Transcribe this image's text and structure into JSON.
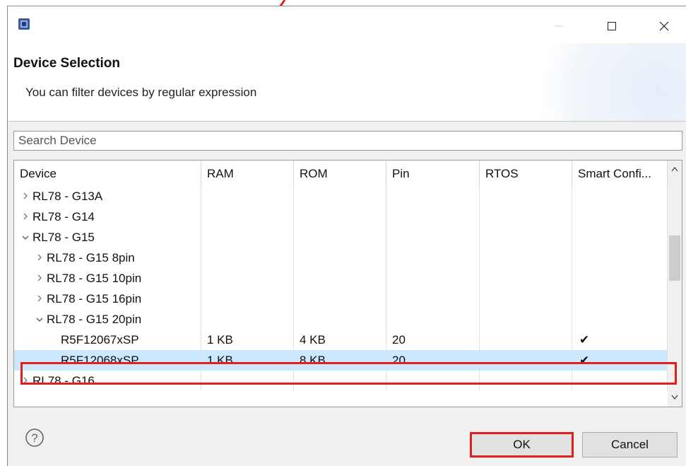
{
  "dialog": {
    "title": "Device Selection",
    "message": "You can filter devices by regular expression"
  },
  "search": {
    "placeholder": "Search Device",
    "value": ""
  },
  "table": {
    "columns": [
      "Device",
      "RAM",
      "ROM",
      "Pin",
      "RTOS",
      "Smart Confi..."
    ],
    "rows": [
      {
        "device": "RL78 - G13A",
        "expander": "collapsed",
        "indent": 0,
        "ram": "",
        "rom": "",
        "pin": "",
        "rtos": "",
        "smart": ""
      },
      {
        "device": "RL78 - G14",
        "expander": "collapsed",
        "indent": 0,
        "ram": "",
        "rom": "",
        "pin": "",
        "rtos": "",
        "smart": ""
      },
      {
        "device": "RL78 - G15",
        "expander": "expanded",
        "indent": 0,
        "ram": "",
        "rom": "",
        "pin": "",
        "rtos": "",
        "smart": ""
      },
      {
        "device": "RL78 - G15 8pin",
        "expander": "collapsed",
        "indent": 1,
        "ram": "",
        "rom": "",
        "pin": "",
        "rtos": "",
        "smart": ""
      },
      {
        "device": "RL78 - G15 10pin",
        "expander": "collapsed",
        "indent": 1,
        "ram": "",
        "rom": "",
        "pin": "",
        "rtos": "",
        "smart": ""
      },
      {
        "device": "RL78 - G15 16pin",
        "expander": "collapsed",
        "indent": 1,
        "ram": "",
        "rom": "",
        "pin": "",
        "rtos": "",
        "smart": ""
      },
      {
        "device": "RL78 - G15 20pin",
        "expander": "expanded",
        "indent": 1,
        "ram": "",
        "rom": "",
        "pin": "",
        "rtos": "",
        "smart": ""
      },
      {
        "device": "R5F12067xSP",
        "expander": "none",
        "indent": 2,
        "ram": "1 KB",
        "rom": "4 KB",
        "pin": "20",
        "rtos": "",
        "smart": "✔"
      },
      {
        "device": "R5F12068xSP",
        "expander": "none",
        "indent": 2,
        "ram": "1 KB",
        "rom": "8 KB",
        "pin": "20",
        "rtos": "",
        "smart": "✔",
        "selected": true
      },
      {
        "device": "RL78 - G16",
        "expander": "collapsed",
        "indent": 0,
        "ram": "",
        "rom": "",
        "pin": "",
        "rtos": "",
        "smart": ""
      }
    ]
  },
  "buttons": {
    "ok": "OK",
    "cancel": "Cancel"
  },
  "icons": {
    "app": "chip-app-icon",
    "minimize": "minimize-icon",
    "maximize": "maximize-icon",
    "close": "close-icon",
    "help": "help-icon",
    "expand": "chevron-right-icon",
    "collapse": "chevron-down-icon",
    "check": "checkmark-icon"
  },
  "colors": {
    "selection": "#cce8ff",
    "annotation": "#e02020"
  }
}
